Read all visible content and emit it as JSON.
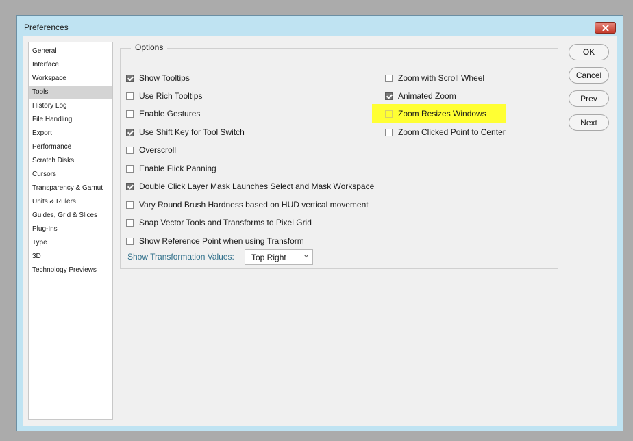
{
  "window": {
    "title": "Preferences"
  },
  "sidebar": {
    "items": [
      {
        "label": "General",
        "selected": false
      },
      {
        "label": "Interface",
        "selected": false
      },
      {
        "label": "Workspace",
        "selected": false
      },
      {
        "label": "Tools",
        "selected": true
      },
      {
        "label": "History Log",
        "selected": false
      },
      {
        "label": "File Handling",
        "selected": false
      },
      {
        "label": "Export",
        "selected": false
      },
      {
        "label": "Performance",
        "selected": false
      },
      {
        "label": "Scratch Disks",
        "selected": false
      },
      {
        "label": "Cursors",
        "selected": false
      },
      {
        "label": "Transparency & Gamut",
        "selected": false
      },
      {
        "label": "Units & Rulers",
        "selected": false
      },
      {
        "label": "Guides, Grid & Slices",
        "selected": false
      },
      {
        "label": "Plug-Ins",
        "selected": false
      },
      {
        "label": "Type",
        "selected": false
      },
      {
        "label": "3D",
        "selected": false
      },
      {
        "label": "Technology Previews",
        "selected": false
      }
    ]
  },
  "options": {
    "legend": "Options",
    "left": [
      {
        "label": "Show Tooltips",
        "checked": true
      },
      {
        "label": "Use Rich Tooltips",
        "checked": false
      },
      {
        "label": "Enable Gestures",
        "checked": false
      },
      {
        "label": "Use Shift Key for Tool Switch",
        "checked": true
      },
      {
        "label": "Overscroll",
        "checked": false
      },
      {
        "label": "Enable Flick Panning",
        "checked": false
      },
      {
        "label": "Double Click Layer Mask Launches Select and Mask Workspace",
        "checked": true
      },
      {
        "label": "Vary Round Brush Hardness based on HUD vertical movement",
        "checked": false
      },
      {
        "label": "Snap Vector Tools and Transforms to Pixel Grid",
        "checked": false
      },
      {
        "label": "Show Reference Point when using Transform",
        "checked": false
      }
    ],
    "right": [
      {
        "label": "Zoom with Scroll Wheel",
        "checked": false
      },
      {
        "label": "Animated Zoom",
        "checked": true
      },
      {
        "label": "Zoom Resizes Windows",
        "checked": false,
        "highlighted": true
      },
      {
        "label": "Zoom Clicked Point to Center",
        "checked": false
      }
    ],
    "highlight_color": "#ffff33",
    "transformation": {
      "label": "Show Transformation Values:",
      "value": "Top Right"
    }
  },
  "buttons": {
    "ok": "OK",
    "cancel": "Cancel",
    "prev": "Prev",
    "next": "Next"
  },
  "colors": {
    "title_bar": "#bfe3f2",
    "close_button": "#c63b2c",
    "accent_label": "#2f6f8a"
  }
}
